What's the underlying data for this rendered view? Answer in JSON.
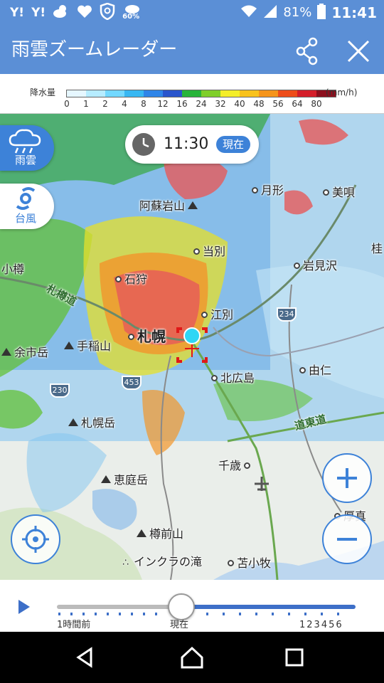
{
  "status_bar": {
    "left_icons": [
      "yahoo-icon",
      "yahoo-icon",
      "weather-icon",
      "heart-icon",
      "shield-icon",
      "rain-icon"
    ],
    "yahoo_text": "Y!",
    "rain_percent": "60%",
    "battery": "81%",
    "time": "11:41"
  },
  "app_bar": {
    "title": "雨雲ズームレーダー",
    "share_icon": "share-icon",
    "close_icon": "close-icon"
  },
  "legend": {
    "label": "降水量",
    "unit": "(mm/h)",
    "ticks": [
      "0",
      "1",
      "2",
      "4",
      "8",
      "12",
      "16",
      "24",
      "32",
      "40",
      "48",
      "56",
      "64",
      "80"
    ],
    "colors": [
      "#e6f7ff",
      "#b6ecff",
      "#72d8ff",
      "#37b7f2",
      "#2f85e8",
      "#2a55cc",
      "#28b43a",
      "#7fcf2a",
      "#f4ee2a",
      "#f8c21c",
      "#f5941a",
      "#ee4d1a",
      "#d41e2a",
      "#8c0f1d"
    ]
  },
  "map": {
    "time_display": "11:30",
    "now_badge": "現在",
    "rain_button": "雨雲",
    "typhoon_button": "台風",
    "places": {
      "sapporo": "札幌",
      "asoiwayama": "阿蘇岩山",
      "tsukigata": "月形",
      "biba": "美唄",
      "tobetsu": "当別",
      "otaru": "小樽",
      "ishikari": "石狩",
      "iwamizawa": "岩見沢",
      "katsura": "桂",
      "ebetsu": "江別",
      "teineyama": "手稲山",
      "yoichidake": "余市岳",
      "yuni": "由仁",
      "kitahiroshima": "北広島",
      "sapporodake": "札幌岳",
      "chitose": "千歳",
      "eniwadake": "恵庭岳",
      "tarumaezan": "樽前山",
      "inkura": "インクラの滝",
      "tomakomai": "苫小牧",
      "atsuma": "厚真"
    },
    "roads": {
      "sasson": "札樽道",
      "doto": "道東道"
    },
    "shields": [
      "234",
      "230",
      "453"
    ]
  },
  "timeline": {
    "label_past": "1時間前",
    "label_now": "現在",
    "label_future": "123456"
  },
  "nav_bar": {
    "back_icon": "back-icon",
    "home_icon": "home-icon",
    "recents_icon": "recents-icon"
  }
}
